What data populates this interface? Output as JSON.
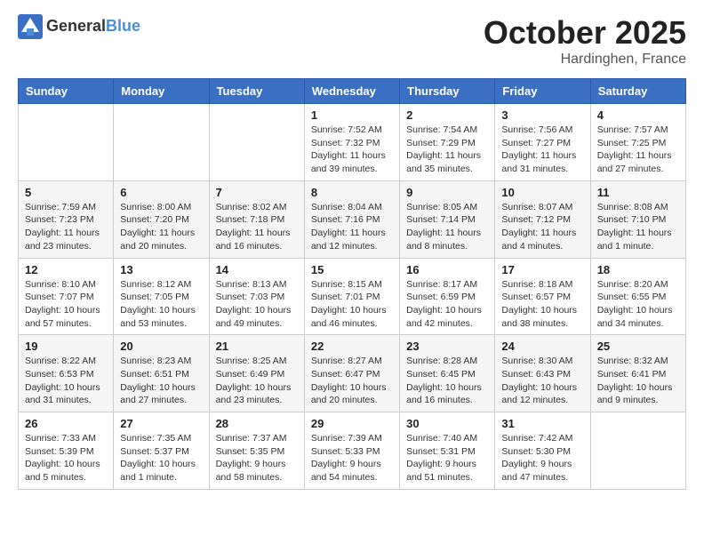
{
  "header": {
    "logo_general": "General",
    "logo_blue": "Blue",
    "month_title": "October 2025",
    "location": "Hardinghen, France"
  },
  "days_of_week": [
    "Sunday",
    "Monday",
    "Tuesday",
    "Wednesday",
    "Thursday",
    "Friday",
    "Saturday"
  ],
  "weeks": [
    [
      {
        "day": "",
        "info": ""
      },
      {
        "day": "",
        "info": ""
      },
      {
        "day": "",
        "info": ""
      },
      {
        "day": "1",
        "info": "Sunrise: 7:52 AM\nSunset: 7:32 PM\nDaylight: 11 hours\nand 39 minutes."
      },
      {
        "day": "2",
        "info": "Sunrise: 7:54 AM\nSunset: 7:29 PM\nDaylight: 11 hours\nand 35 minutes."
      },
      {
        "day": "3",
        "info": "Sunrise: 7:56 AM\nSunset: 7:27 PM\nDaylight: 11 hours\nand 31 minutes."
      },
      {
        "day": "4",
        "info": "Sunrise: 7:57 AM\nSunset: 7:25 PM\nDaylight: 11 hours\nand 27 minutes."
      }
    ],
    [
      {
        "day": "5",
        "info": "Sunrise: 7:59 AM\nSunset: 7:23 PM\nDaylight: 11 hours\nand 23 minutes."
      },
      {
        "day": "6",
        "info": "Sunrise: 8:00 AM\nSunset: 7:20 PM\nDaylight: 11 hours\nand 20 minutes."
      },
      {
        "day": "7",
        "info": "Sunrise: 8:02 AM\nSunset: 7:18 PM\nDaylight: 11 hours\nand 16 minutes."
      },
      {
        "day": "8",
        "info": "Sunrise: 8:04 AM\nSunset: 7:16 PM\nDaylight: 11 hours\nand 12 minutes."
      },
      {
        "day": "9",
        "info": "Sunrise: 8:05 AM\nSunset: 7:14 PM\nDaylight: 11 hours\nand 8 minutes."
      },
      {
        "day": "10",
        "info": "Sunrise: 8:07 AM\nSunset: 7:12 PM\nDaylight: 11 hours\nand 4 minutes."
      },
      {
        "day": "11",
        "info": "Sunrise: 8:08 AM\nSunset: 7:10 PM\nDaylight: 11 hours\nand 1 minute."
      }
    ],
    [
      {
        "day": "12",
        "info": "Sunrise: 8:10 AM\nSunset: 7:07 PM\nDaylight: 10 hours\nand 57 minutes."
      },
      {
        "day": "13",
        "info": "Sunrise: 8:12 AM\nSunset: 7:05 PM\nDaylight: 10 hours\nand 53 minutes."
      },
      {
        "day": "14",
        "info": "Sunrise: 8:13 AM\nSunset: 7:03 PM\nDaylight: 10 hours\nand 49 minutes."
      },
      {
        "day": "15",
        "info": "Sunrise: 8:15 AM\nSunset: 7:01 PM\nDaylight: 10 hours\nand 46 minutes."
      },
      {
        "day": "16",
        "info": "Sunrise: 8:17 AM\nSunset: 6:59 PM\nDaylight: 10 hours\nand 42 minutes."
      },
      {
        "day": "17",
        "info": "Sunrise: 8:18 AM\nSunset: 6:57 PM\nDaylight: 10 hours\nand 38 minutes."
      },
      {
        "day": "18",
        "info": "Sunrise: 8:20 AM\nSunset: 6:55 PM\nDaylight: 10 hours\nand 34 minutes."
      }
    ],
    [
      {
        "day": "19",
        "info": "Sunrise: 8:22 AM\nSunset: 6:53 PM\nDaylight: 10 hours\nand 31 minutes."
      },
      {
        "day": "20",
        "info": "Sunrise: 8:23 AM\nSunset: 6:51 PM\nDaylight: 10 hours\nand 27 minutes."
      },
      {
        "day": "21",
        "info": "Sunrise: 8:25 AM\nSunset: 6:49 PM\nDaylight: 10 hours\nand 23 minutes."
      },
      {
        "day": "22",
        "info": "Sunrise: 8:27 AM\nSunset: 6:47 PM\nDaylight: 10 hours\nand 20 minutes."
      },
      {
        "day": "23",
        "info": "Sunrise: 8:28 AM\nSunset: 6:45 PM\nDaylight: 10 hours\nand 16 minutes."
      },
      {
        "day": "24",
        "info": "Sunrise: 8:30 AM\nSunset: 6:43 PM\nDaylight: 10 hours\nand 12 minutes."
      },
      {
        "day": "25",
        "info": "Sunrise: 8:32 AM\nSunset: 6:41 PM\nDaylight: 10 hours\nand 9 minutes."
      }
    ],
    [
      {
        "day": "26",
        "info": "Sunrise: 7:33 AM\nSunset: 5:39 PM\nDaylight: 10 hours\nand 5 minutes."
      },
      {
        "day": "27",
        "info": "Sunrise: 7:35 AM\nSunset: 5:37 PM\nDaylight: 10 hours\nand 1 minute."
      },
      {
        "day": "28",
        "info": "Sunrise: 7:37 AM\nSunset: 5:35 PM\nDaylight: 9 hours\nand 58 minutes."
      },
      {
        "day": "29",
        "info": "Sunrise: 7:39 AM\nSunset: 5:33 PM\nDaylight: 9 hours\nand 54 minutes."
      },
      {
        "day": "30",
        "info": "Sunrise: 7:40 AM\nSunset: 5:31 PM\nDaylight: 9 hours\nand 51 minutes."
      },
      {
        "day": "31",
        "info": "Sunrise: 7:42 AM\nSunset: 5:30 PM\nDaylight: 9 hours\nand 47 minutes."
      },
      {
        "day": "",
        "info": ""
      }
    ]
  ]
}
